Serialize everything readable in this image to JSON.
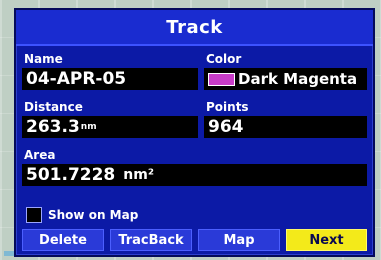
{
  "window": {
    "title": "Track"
  },
  "fields": {
    "name_label": "Name",
    "name_value": "04-APR-05",
    "color_label": "Color",
    "color_value": "Dark Magenta",
    "distance_label": "Distance",
    "distance_value": "263.3",
    "distance_unit": "nm",
    "points_label": "Points",
    "points_value": "964",
    "area_label": "Area",
    "area_value": "501.7228",
    "area_unit": "nm²"
  },
  "show_on_map": {
    "label": "Show on Map",
    "checked": false
  },
  "buttons": {
    "delete": "Delete",
    "tracback": "TracBack",
    "map": "Map",
    "next": "Next"
  },
  "colors": {
    "panel": "#0c1aa6",
    "titlebar": "#1a2cd0",
    "active_button": "#f3ea1a",
    "swatch_dark_magenta": "#c83cc8"
  }
}
